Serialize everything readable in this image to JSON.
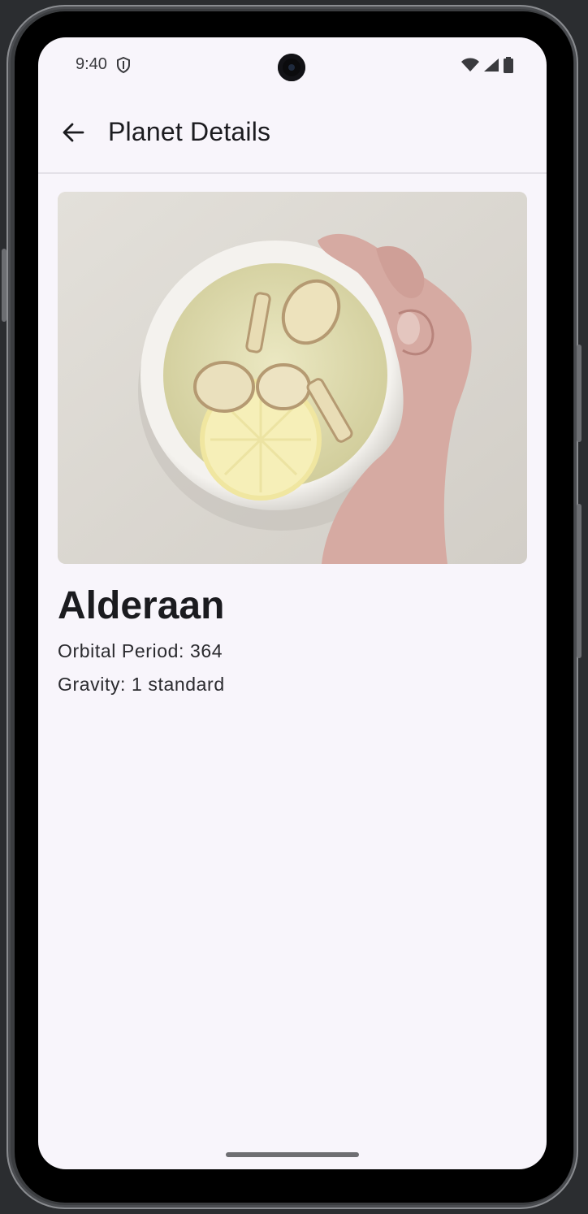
{
  "status_bar": {
    "time": "9:40",
    "icons": [
      "shield-icon",
      "wifi-icon",
      "cellular-signal-icon",
      "battery-icon"
    ]
  },
  "app_bar": {
    "title": "Planet Details",
    "back_icon": "arrow-back-icon"
  },
  "planet": {
    "name": "Alderaan",
    "orbital_period_line": "Orbital Period: 364",
    "gravity_line": "Gravity: 1 standard",
    "image": "photo of a bowl of ginger lemon tea held by a hand"
  },
  "colors": {
    "screen_background": "#f8f5fb",
    "text_primary": "#1b1b1f",
    "divider": "#e4e1e8"
  }
}
